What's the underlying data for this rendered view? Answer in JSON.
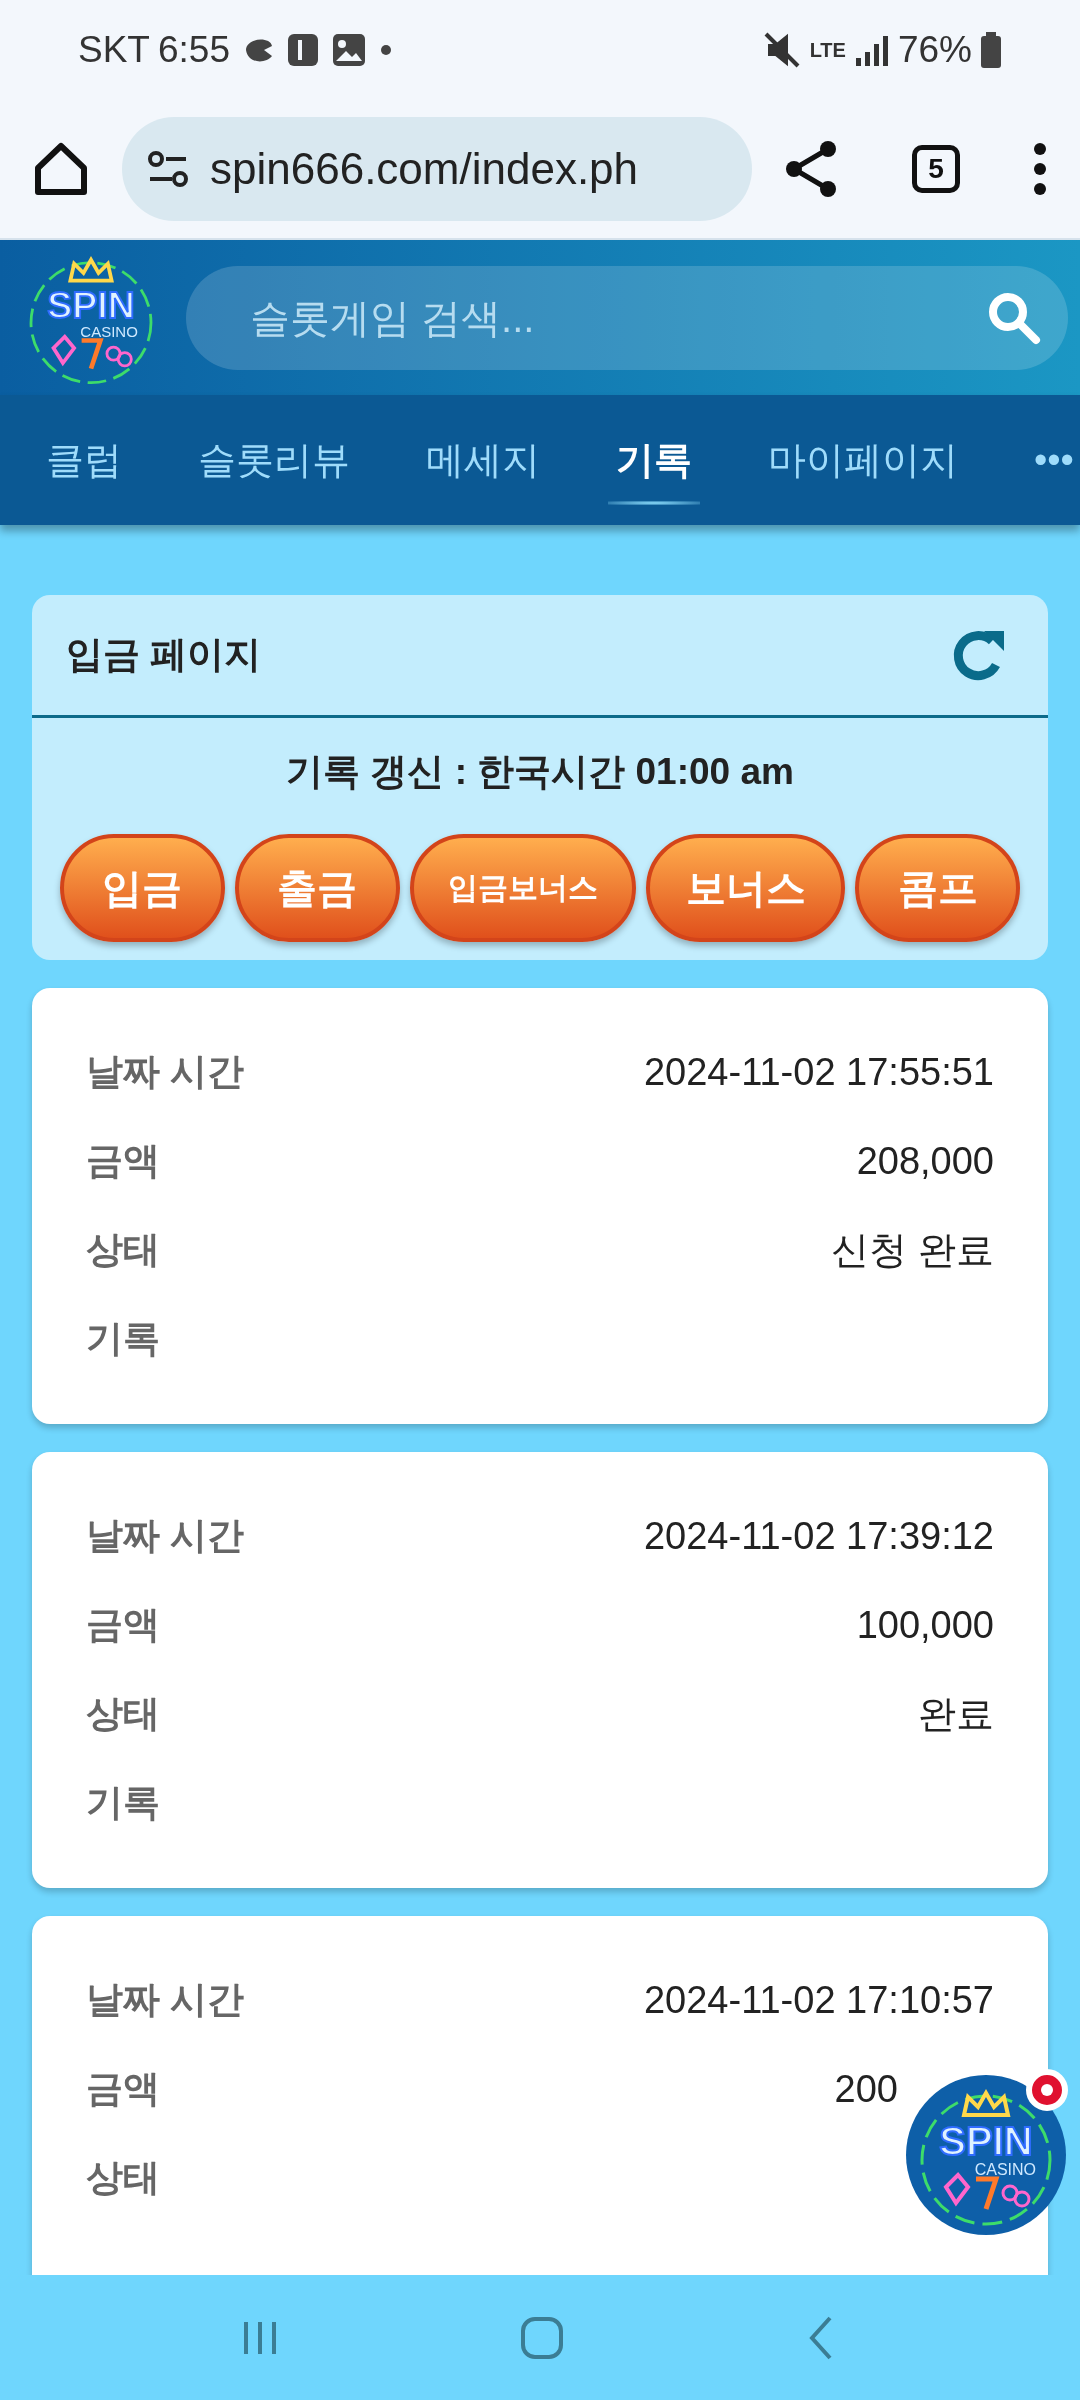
{
  "status_bar": {
    "carrier": "SKT",
    "time": "6:55",
    "network": "LTE",
    "battery": "76%"
  },
  "browser": {
    "url": "spin666.com/index.ph",
    "tab_count": "5"
  },
  "header": {
    "logo": {
      "title": "SPIN",
      "subtitle": "CASINO"
    },
    "search": {
      "placeholder": "슬롯게임 검색..."
    }
  },
  "nav_tabs": [
    {
      "label": "클럽",
      "selected": false
    },
    {
      "label": "슬롯리뷰",
      "selected": false
    },
    {
      "label": "메세지",
      "selected": false
    },
    {
      "label": "기록",
      "selected": true
    },
    {
      "label": "마이페이지",
      "selected": false
    },
    {
      "label": "•••",
      "selected": false
    }
  ],
  "panel": {
    "title": "입금 페이지",
    "notice": "기록 갱신 : 한국시간 01:00 am",
    "buttons": [
      "입금",
      "출금",
      "입금보너스",
      "보너스",
      "콤프"
    ]
  },
  "records": [
    {
      "rows": [
        {
          "label": "날짜 시간",
          "value": "2024-11-02 17:55:51"
        },
        {
          "label": "금액",
          "value": "208,000"
        },
        {
          "label": "상태",
          "value": "신청 완료"
        },
        {
          "label": "기록",
          "value": ""
        }
      ]
    },
    {
      "rows": [
        {
          "label": "날짜 시간",
          "value": "2024-11-02 17:39:12"
        },
        {
          "label": "금액",
          "value": "100,000"
        },
        {
          "label": "상태",
          "value": "완료"
        },
        {
          "label": "기록",
          "value": ""
        }
      ]
    },
    {
      "rows": [
        {
          "label": "날짜 시간",
          "value": "2024-11-02 17:10:57"
        },
        {
          "label": "금액",
          "value": "200"
        },
        {
          "label": "상태",
          "value": ""
        }
      ]
    }
  ],
  "floating_button": {
    "logo": {
      "title": "SPIN",
      "subtitle": "CASINO"
    },
    "notification": true
  }
}
